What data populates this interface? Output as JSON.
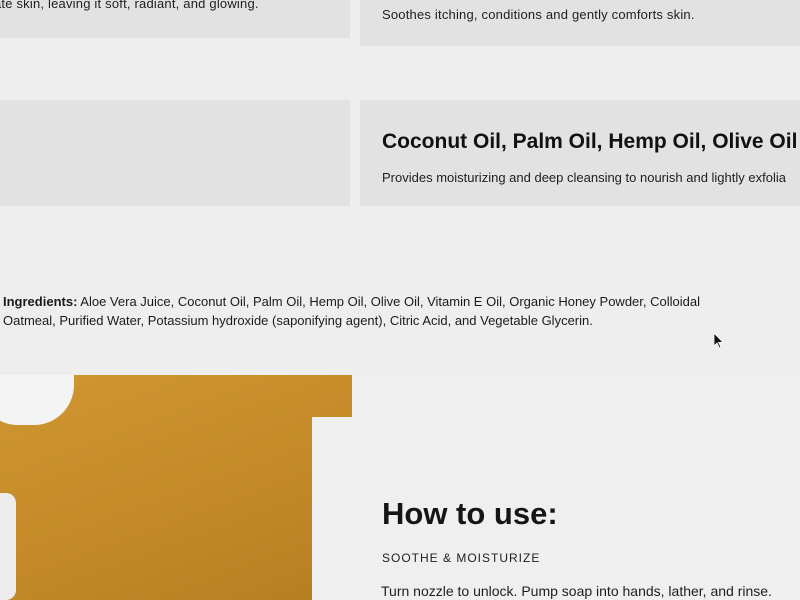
{
  "top_cards": {
    "left_text": "ate skin, leaving it soft, radiant, and glowing.",
    "right_text": "Soothes itching, conditions and gently comforts skin."
  },
  "benefit": {
    "title": "Coconut Oil, Palm Oil, Hemp Oil, Olive Oil",
    "description": "Provides moisturizing and deep cleansing to nourish and lightly exfolia"
  },
  "ingredients": {
    "label": "Ingredients:",
    "text": " Aloe Vera Juice, Coconut Oil, Palm Oil, Hemp Oil, Olive Oil, Vitamin E Oil, Organic Honey Powder, Colloidal Oatmeal, Purified Water, Potassium hydroxide (saponifying agent), Citric Acid, and Vegetable Glycerin."
  },
  "how_to_use": {
    "title": "How to use:",
    "subtitle": "SOOTHE & MOISTURIZE",
    "text": "Turn nozzle to unlock. Pump soap into hands, lather, and rinse."
  },
  "colors": {
    "product_image": "#c8902c",
    "card_bg": "#e2e2e2",
    "page_bg": "#eeeeee"
  },
  "icons": {
    "cursor": "mouse-cursor-icon"
  }
}
